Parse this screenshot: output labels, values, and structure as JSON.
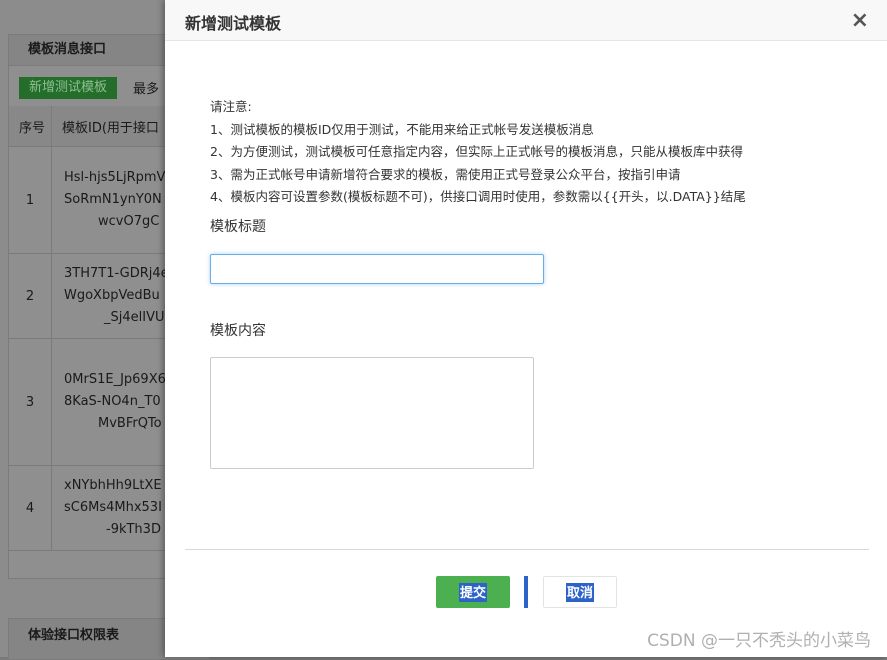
{
  "background": {
    "panel_title": "模板消息接口",
    "add_button": "新增测试模板",
    "toolbar_note": "最多",
    "columns": [
      "序号",
      "模板ID(用于接口"
    ],
    "rows": [
      {
        "num": "1",
        "lines": [
          "Hsl-hjs5LjRpmV",
          "SoRmN1ynY0N",
          "wcvO7gC"
        ]
      },
      {
        "num": "2",
        "lines": [
          "3TH7T1-GDRj4e",
          "WgoXbpVedBu",
          "_Sj4elIVU"
        ]
      },
      {
        "num": "3",
        "lines": [
          "0MrS1E_Jp69X6",
          "8KaS-NO4n_T0",
          "MvBFrQTo"
        ]
      },
      {
        "num": "4",
        "lines": [
          "xNYbhHh9LtXE",
          "sC6Ms4Mhx53I",
          "-9kTh3D"
        ]
      }
    ],
    "panel2_title": "体验接口权限表"
  },
  "modal": {
    "title": "新增测试模板",
    "close_symbol": "×",
    "notice": {
      "heading": "请注意:",
      "items": [
        "1、测试模板的模板ID仅用于测试，不能用来给正式帐号发送模板消息",
        "2、为方便测试，测试模板可任意指定内容，但实际上正式帐号的模板消息，只能从模板库中获得",
        "3、需为正式帐号申请新增符合要求的模板，需使用正式号登录公众平台，按指引申请",
        "4、模板内容可设置参数(模板标题不可)，供接口调用时使用，参数需以{{开头，以.DATA}}结尾"
      ]
    },
    "title_label": "模板标题",
    "title_value": "",
    "content_label": "模板内容",
    "content_value": "",
    "submit_label": "提交",
    "cancel_label": "取消"
  },
  "watermark": "CSDN @一只不秃头的小菜鸟",
  "colors": {
    "submit_bg": "#4caf50",
    "selection": "#2d63c8",
    "input_focus": "#66afe9"
  }
}
